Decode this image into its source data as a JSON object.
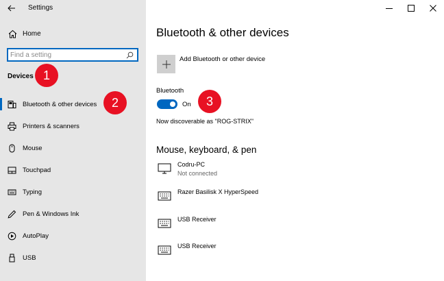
{
  "window": {
    "title": "Settings"
  },
  "sidebar": {
    "home_label": "Home",
    "search_placeholder": "Find a setting",
    "section_title": "Devices",
    "items": [
      {
        "label": "Bluetooth & other devices",
        "icon": "bluetooth-devices-icon",
        "active": true
      },
      {
        "label": "Printers & scanners",
        "icon": "printer-icon"
      },
      {
        "label": "Mouse",
        "icon": "mouse-icon"
      },
      {
        "label": "Touchpad",
        "icon": "touchpad-icon"
      },
      {
        "label": "Typing",
        "icon": "keyboard-icon"
      },
      {
        "label": "Pen & Windows Ink",
        "icon": "pen-icon"
      },
      {
        "label": "AutoPlay",
        "icon": "autoplay-icon"
      },
      {
        "label": "USB",
        "icon": "usb-icon"
      }
    ]
  },
  "badges": [
    "1",
    "2",
    "3"
  ],
  "main": {
    "page_title": "Bluetooth & other devices",
    "add_device_label": "Add Bluetooth or other device",
    "bluetooth_label": "Bluetooth",
    "bluetooth_state": "On",
    "bluetooth_on": true,
    "discoverable_text": "Now discoverable as \"ROG-STRIX\"",
    "section_title": "Mouse, keyboard, & pen",
    "devices": [
      {
        "name": "Codru-PC",
        "status": "Not connected",
        "icon": "monitor-icon"
      },
      {
        "name": "Razer Basilisk X HyperSpeed",
        "status": "",
        "icon": "keyboard-icon"
      },
      {
        "name": "USB Receiver",
        "status": "",
        "icon": "keyboard-icon"
      },
      {
        "name": "USB Receiver",
        "status": "",
        "icon": "keyboard-icon"
      }
    ]
  },
  "colors": {
    "accent": "#0067c0",
    "sidebar_bg": "#e6e6e6",
    "badge": "#e81123"
  }
}
